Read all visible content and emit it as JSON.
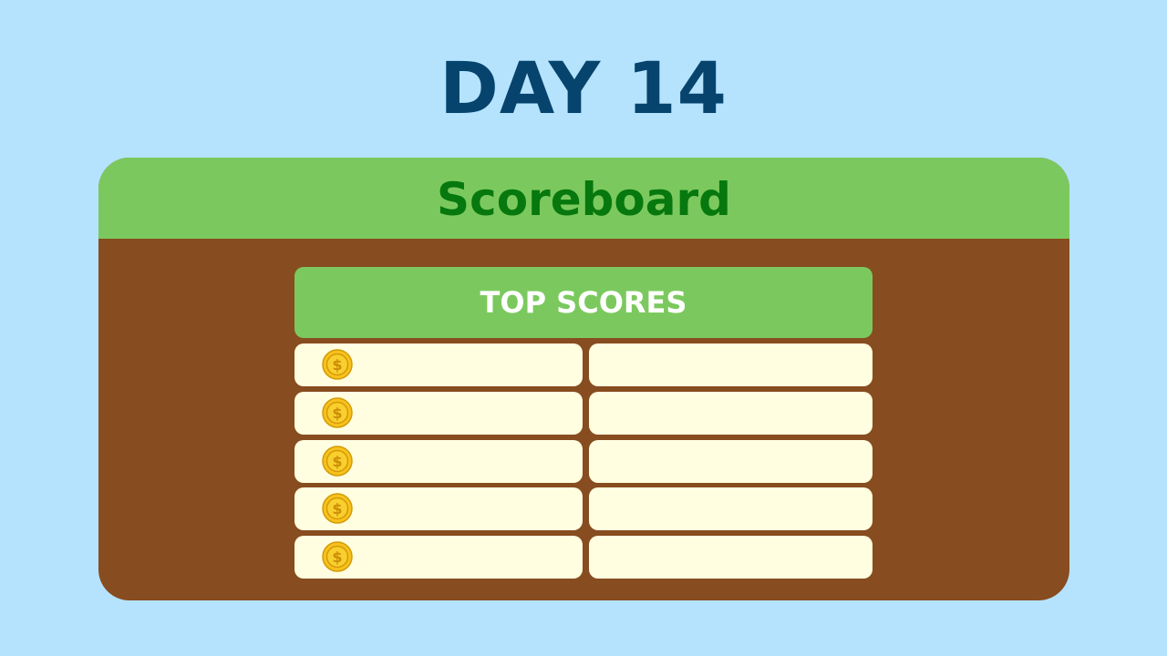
{
  "day_title": "DAY 14",
  "board": {
    "title": "Scoreboard",
    "top_scores_title": "TOP SCORES",
    "rows": [
      {
        "icon": "coin-icon",
        "name": "",
        "score": ""
      },
      {
        "icon": "coin-icon",
        "name": "",
        "score": ""
      },
      {
        "icon": "coin-icon",
        "name": "",
        "score": ""
      },
      {
        "icon": "coin-icon",
        "name": "",
        "score": ""
      },
      {
        "icon": "coin-icon",
        "name": "",
        "score": ""
      }
    ]
  },
  "colors": {
    "background": "#b5e3fd",
    "title": "#06446e",
    "board_body": "#874c1f",
    "header_green": "#7bc95e",
    "scoreboard_text": "#06780e",
    "cell": "#fffee0",
    "coin": "#f6c21c"
  }
}
